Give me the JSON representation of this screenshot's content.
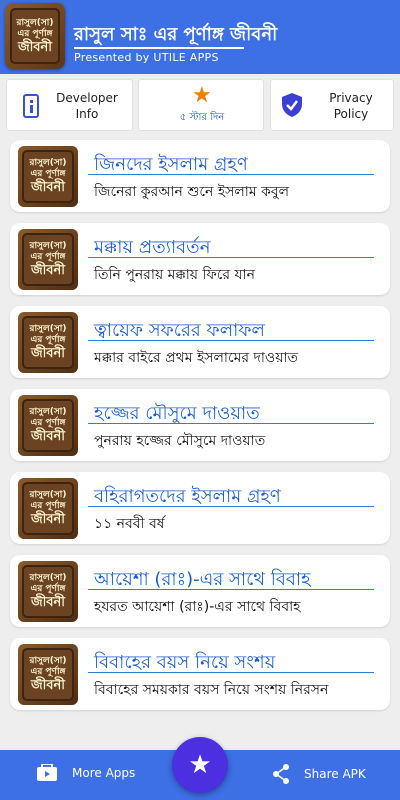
{
  "header": {
    "title": "রাসুল সাঃ এর পূর্ণাঙ্গ জীবনী",
    "subtitle": "Presented by UTILE APPS",
    "logo_text": [
      "রাসুল(সা)",
      "এর পূর্ণাঙ্গ",
      "জীবনী"
    ]
  },
  "actions": [
    {
      "label": "Developer\nInfo",
      "icon": "info-icon"
    },
    {
      "label": "৫ স্টার দিন",
      "icon": "star-icon"
    },
    {
      "label": "Privacy\nPolicy",
      "icon": "shield-check-icon"
    }
  ],
  "chapters": [
    {
      "title": "জিনদের ইসলাম গ্রহণ",
      "subtitle": "জিনেরা কুরআন শুনে ইসলাম কবুল"
    },
    {
      "title": "মক্কায় প্রত্যাবর্তন",
      "subtitle": "তিনি পুনরায় মক্কায় ফিরে যান"
    },
    {
      "title": "ত্বায়েফ সফরের ফলাফল",
      "subtitle": "মক্কার বাইরে প্রথম ইসলামের দাওয়াত"
    },
    {
      "title": "হজ্জের মৌসুমে দাওয়াত",
      "subtitle": "পুনরায় হজ্জের মৌসুমে দাওয়াত"
    },
    {
      "title": "বহিরাগতদের ইসলাম গ্রহণ",
      "subtitle": "১১ নববী বর্ষ"
    },
    {
      "title": "আয়েশা (রাঃ)-এর সাথে বিবাহ",
      "subtitle": "হযরত আয়েশা (রাঃ)-এর সাথে বিবাহ"
    },
    {
      "title": "বিবাহের বয়স নিয়ে সংশয়",
      "subtitle": "বিবাহের সময়কার বয়স নিয়ে সংশয় নিরসন"
    }
  ],
  "bottom_bar": {
    "left_label": "More Apps",
    "right_label": "Share APK",
    "fab_icon": "star-icon"
  },
  "colors": {
    "primary": "#3d6fe5",
    "fab": "#4b2fe0",
    "title_text": "#1b5bd0",
    "star": "#f07c00"
  }
}
